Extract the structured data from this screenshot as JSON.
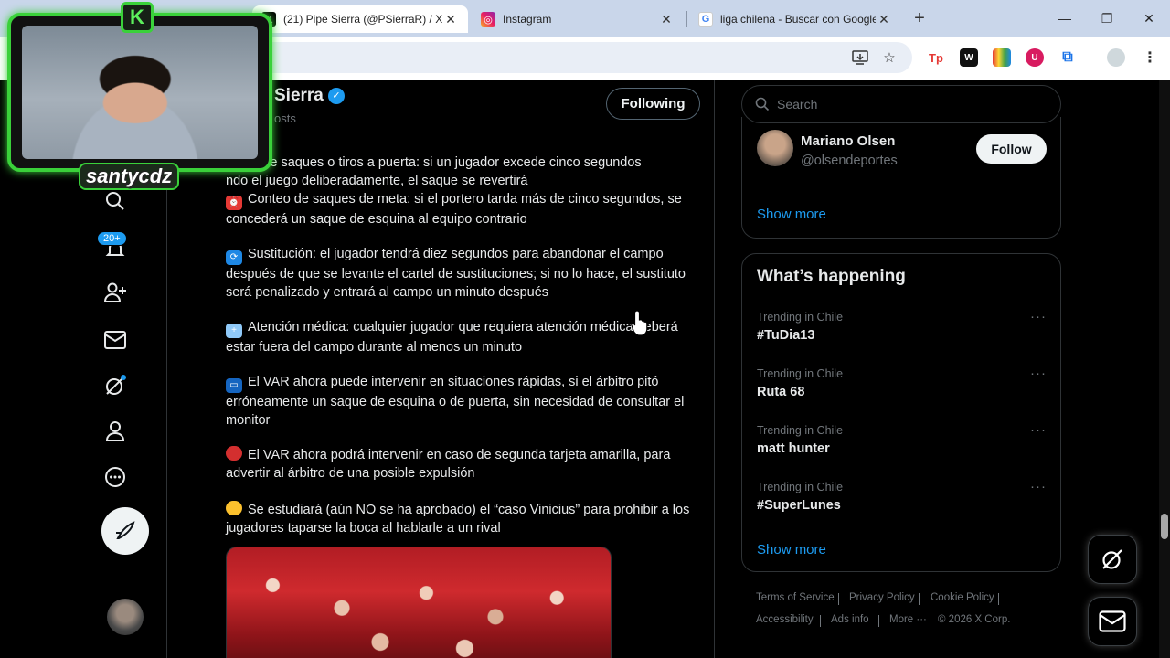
{
  "browser": {
    "tabs": [
      {
        "title": "(21) Pipe Sierra (@PSierraR) / X",
        "active": true
      },
      {
        "title": "Instagram",
        "active": false
      },
      {
        "title": "liga chilena - Buscar con Google",
        "active": false
      }
    ],
    "new_tab": "+",
    "window_controls": {
      "minimize": "—",
      "restore": "❐",
      "close": "✕"
    }
  },
  "nav": {
    "notifications_badge": "20+"
  },
  "profile": {
    "name_partial": "Sierra",
    "posts_partial": "osts",
    "following_label": "Following"
  },
  "tweet": {
    "paragraphs": [
      {
        "emoji": "",
        "text": "uento de saques o tiros a puerta: si un jugador excede cinco segundos\nndo el juego deliberadamente, el saque se revertirá"
      },
      {
        "emoji": "⏰",
        "text": "Conteo de saques de meta: si el portero tarda más de cinco segundos, se concederá un saque de esquina al equipo contrario"
      },
      {
        "emoji": "🔄",
        "text": "Sustitución: el jugador tendrá diez segundos para abandonar el campo después de que se levante el cartel de sustituciones; si no lo hace, el sustituto será penalizado y entrará al campo un minuto después"
      },
      {
        "emoji": "🏥",
        "text": "Atención médica: cualquier jugador que requiera atención médica deberá estar fuera del campo durante al menos un minuto"
      },
      {
        "emoji": "📺",
        "text": "El VAR ahora puede intervenir en situaciones rápidas, si el árbitro pitó erróneamente un saque de esquina o de puerta, sin necesidad de consultar el monitor"
      },
      {
        "emoji": "🛑",
        "text": "El VAR ahora podrá intervenir en caso de segunda tarjeta amarilla, para advertir al árbitro de una posible expulsión"
      },
      {
        "emoji": "🤫",
        "text": "Se estudiará (aún NO se ha aprobado) el “caso Vinicius” para prohibir a los jugadores taparse la boca al hablarle a un rival"
      }
    ]
  },
  "right": {
    "search_placeholder": "Search",
    "who_to_follow": {
      "name": "Mariano Olsen",
      "handle": "@olsendeportes",
      "follow_label": "Follow",
      "show_more": "Show more"
    },
    "whats_happening": {
      "title": "What’s happening",
      "trends": [
        {
          "context": "Trending in Chile",
          "name": "#TuDia13"
        },
        {
          "context": "Trending in Chile",
          "name": "Ruta 68"
        },
        {
          "context": "Trending in Chile",
          "name": "matt hunter"
        },
        {
          "context": "Trending in Chile",
          "name": "#SuperLunes"
        }
      ],
      "more": "···",
      "show_more": "Show more"
    },
    "footer": {
      "terms": "Terms of Service",
      "privacy": "Privacy Policy",
      "cookie": "Cookie Policy",
      "accessibility": "Accessibility",
      "ads": "Ads info",
      "more": "More ···",
      "copyright": "© 2026 X Corp."
    }
  },
  "overlay": {
    "k_logo": "K",
    "streamer_name": "santycdz"
  },
  "colors": {
    "accent": "#1d9bf0",
    "overlay_green": "#3ad13a"
  }
}
